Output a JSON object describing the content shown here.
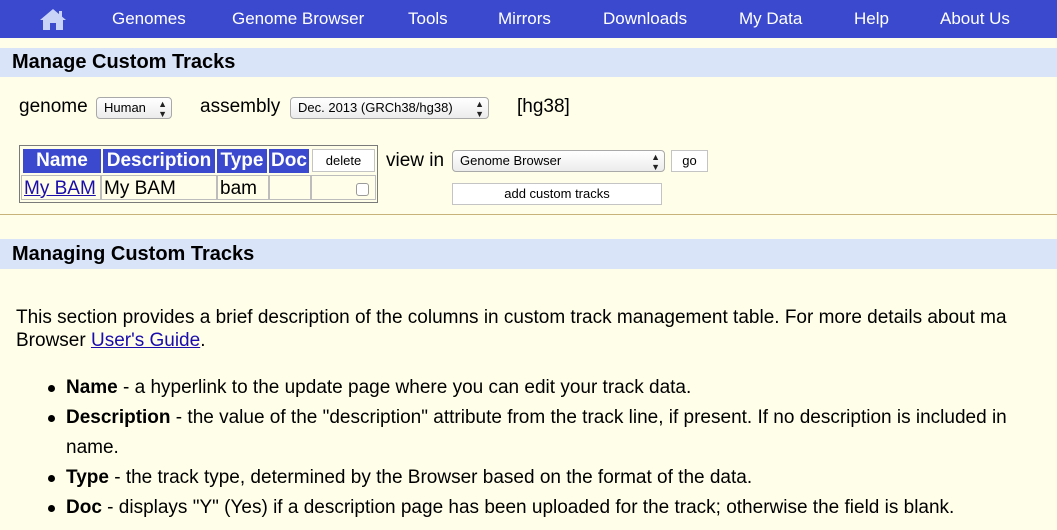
{
  "nav": {
    "items": [
      "Genomes",
      "Genome Browser",
      "Tools",
      "Mirrors",
      "Downloads",
      "My Data",
      "Help",
      "About Us"
    ]
  },
  "manage": {
    "title": "Manage Custom Tracks",
    "genome_label": "genome",
    "genome_value": "Human",
    "assembly_label": "assembly",
    "assembly_value": "Dec. 2013 (GRCh38/hg38)",
    "db": "[hg38]",
    "table": {
      "headers": [
        "Name",
        "Description",
        "Type",
        "Doc"
      ],
      "delete_button": "delete",
      "rows": [
        {
          "name": "My BAM",
          "description": "My BAM",
          "type": "bam",
          "doc": "",
          "checked": false
        }
      ]
    },
    "view_in_label": "view in",
    "view_in_value": "Genome Browser",
    "go_button": "go",
    "add_button": "add custom tracks"
  },
  "help": {
    "title": "Managing Custom Tracks",
    "intro_line1": "This section provides a brief description of the columns in custom track management table. For more details about ma",
    "intro_line2_prefix": "Browser ",
    "intro_link": "User's Guide",
    "intro_line2_suffix": ".",
    "bullets": [
      {
        "term": "Name",
        "text": " - a hyperlink to the update page where you can edit your track data."
      },
      {
        "term": "Description",
        "text": " - the value of the \"description\" attribute from the track line, if present. If no description is included in",
        "cont": "name."
      },
      {
        "term": "Type",
        "text": " - the track type, determined by the Browser based on the format of the data."
      },
      {
        "term": "Doc",
        "text": " - displays \"Y\" (Yes) if a description page has been uploaded for the track; otherwise the field is blank."
      }
    ]
  },
  "colors": {
    "nav_bg": "#3a49cd",
    "section_bg": "#d9e4f8",
    "page_bg": "#fffee8",
    "link": "#1a0dab"
  }
}
